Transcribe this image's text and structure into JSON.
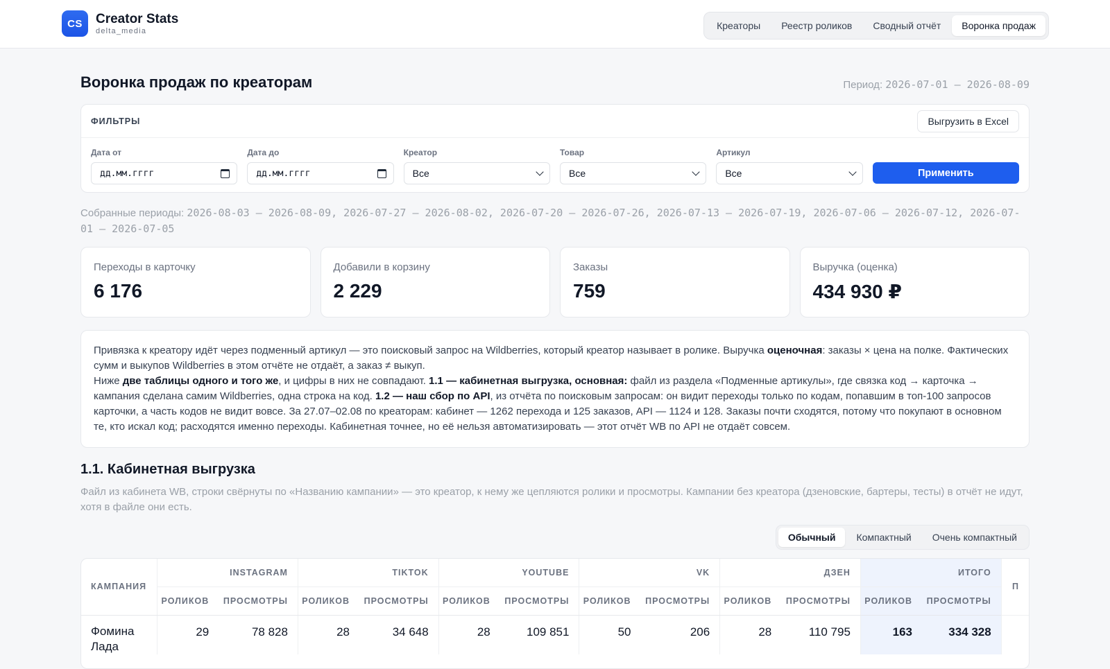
{
  "brand": {
    "logo": "CS",
    "title": "Creator Stats",
    "sub": "delta_media"
  },
  "nav": [
    "Креаторы",
    "Реестр роликов",
    "Сводный отчёт",
    "Воронка продаж"
  ],
  "page": {
    "title": "Воронка продаж по креаторам",
    "period_label": "Период:",
    "period_value": "2026-07-01 — 2026-08-09"
  },
  "filters": {
    "label": "ФИЛЬТРЫ",
    "export": "Выгрузить в Excel",
    "date_from": {
      "label": "Дата от",
      "value": "дд.мм.гггг"
    },
    "date_to": {
      "label": "Дата до",
      "value": "дд.мм.гггг"
    },
    "creator": {
      "label": "Креатор",
      "value": "Все"
    },
    "product": {
      "label": "Товар",
      "value": "Все"
    },
    "article": {
      "label": "Артикул",
      "value": "Все"
    },
    "apply": "Применить"
  },
  "collected": {
    "label": "Собранные периоды:",
    "value": "2026-08-03 — 2026-08-09, 2026-07-27 — 2026-08-02, 2026-07-20 — 2026-07-26, 2026-07-13 — 2026-07-19, 2026-07-06 — 2026-07-12, 2026-07-01 — 2026-07-05"
  },
  "kpis": [
    {
      "label": "Переходы в карточку",
      "value": "6 176"
    },
    {
      "label": "Добавили в корзину",
      "value": "2 229"
    },
    {
      "label": "Заказы",
      "value": "759"
    },
    {
      "label": "Выручка (оценка)",
      "value": "434 930 ₽"
    }
  ],
  "note": {
    "p1a": "Привязка к креатору идёт через подменный артикул — это поисковый запрос на Wildberries, который креатор называет в ролике. Выручка ",
    "p1b": "оценочная",
    "p1c": ": заказы × цена на полке. Фактических сумм и выкупов Wildberries в этом отчёте не отдаёт, а заказ ≠ выкуп.",
    "p2a": "Ниже ",
    "p2b": "две таблицы одного и того же",
    "p2c": ", и цифры в них не совпадают. ",
    "p2d": "1.1 — кабинетная выгрузка, основная:",
    "p2e": " файл из раздела «Подменные артикулы», где связка код → карточка → кампания сделана самим Wildberries, одна строка на код. ",
    "p2f": "1.2 — наш сбор по API",
    "p2g": ", из отчёта по поисковым запросам: он видит переходы только по кодам, попавшим в топ-100 запросов карточки, а часть кодов не видит вовсе. За 27.07–02.08 по креаторам: кабинет — 1262 перехода и 125 заказов, API — 1124 и 128. Заказы почти сходятся, потому что покупают в основном те, кто искал код; расходятся именно переходы. Кабинетная точнее, но её нельзя автоматизировать — этот отчёт WB по API не отдаёт совсем."
  },
  "section": {
    "title": "1.1. Кабинетная выгрузка",
    "desc": "Файл из кабинета WB, строки свёрнуты по «Названию кампании» — это креатор, к нему же цепляются ролики и просмотры. Кампании без креатора (дзеновские, бартеры, тесты) в отчёт не идут, хотя в файле они есть."
  },
  "density": [
    "Обычный",
    "Компактный",
    "Очень компактный"
  ],
  "table": {
    "campaign_header": "КАМПАНИЯ",
    "groups": [
      "INSTAGRAM",
      "TIKTOK",
      "YOUTUBE",
      "VK",
      "ДЗЕН",
      "ИТОГО"
    ],
    "cut_header": "П",
    "sub": {
      "videos": "РОЛИКОВ",
      "views": "ПРОСМОТРЫ"
    },
    "rows": [
      {
        "name": "Фомина Лада",
        "cells": [
          "29",
          "78 828",
          "28",
          "34 648",
          "28",
          "109 851",
          "50",
          "206",
          "28",
          "110 795",
          "163",
          "334 328"
        ]
      }
    ]
  }
}
